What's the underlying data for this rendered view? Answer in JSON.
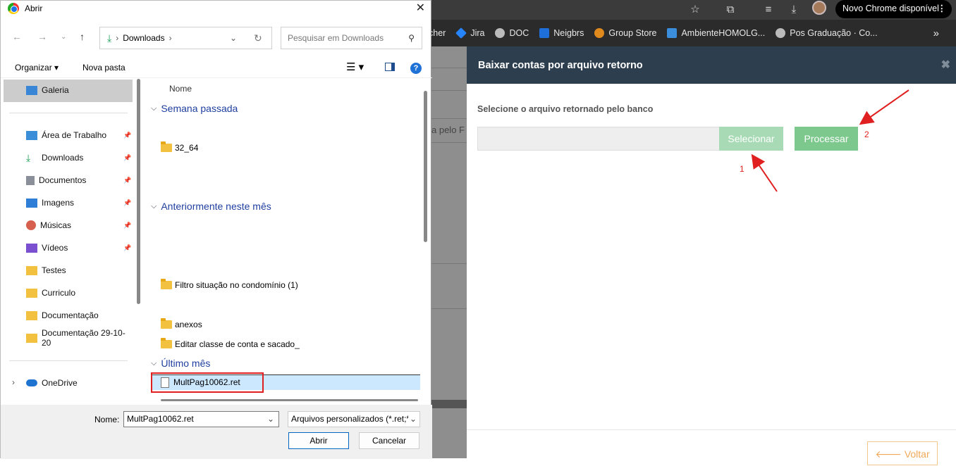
{
  "dialog": {
    "title": "Abrir",
    "address": {
      "crumb": "Downloads"
    },
    "search_placeholder": "Pesquisar em Downloads",
    "organize_label": "Organizar",
    "new_folder_label": "Nova pasta",
    "nav_items": [
      {
        "label": "Galeria",
        "pinned": false
      },
      {
        "label": "Área de Trabalho",
        "pinned": true
      },
      {
        "label": "Downloads",
        "pinned": true
      },
      {
        "label": "Documentos",
        "pinned": true
      },
      {
        "label": "Imagens",
        "pinned": true
      },
      {
        "label": "Músicas",
        "pinned": true
      },
      {
        "label": "Vídeos",
        "pinned": true
      },
      {
        "label": "Testes",
        "pinned": false
      },
      {
        "label": "Curriculo",
        "pinned": false
      },
      {
        "label": "Documentação",
        "pinned": false
      },
      {
        "label": "Documentação 29-10-20",
        "pinned": false
      },
      {
        "label": "OneDrive",
        "pinned": false
      }
    ],
    "column_header": "Nome",
    "groups": [
      {
        "label": "Semana passada"
      },
      {
        "label": "Anteriormente neste mês"
      },
      {
        "label": "Último mês"
      }
    ],
    "files": [
      {
        "name": "32_64"
      },
      {
        "name": "Filtro situação no condomínio (1)"
      },
      {
        "name": "anexos"
      },
      {
        "name": "Editar classe de conta e sacado_"
      },
      {
        "name": "MultPag10062.ret"
      }
    ],
    "name_label": "Nome:",
    "name_value": "MultPag10062.ret",
    "file_type": "Arquivos personalizados (*.ret;*",
    "open_button": "Abrir",
    "cancel_button": "Cancelar"
  },
  "browser": {
    "update_label": "Novo Chrome disponível",
    "bookmarks": [
      {
        "label": "cher",
        "color": "#2b2b2b"
      },
      {
        "label": "Jira",
        "color": "#2684ff"
      },
      {
        "label": "DOC",
        "color": "#bbbbbb"
      },
      {
        "label": "Neigbrs",
        "color": "#1e6fd9"
      },
      {
        "label": "Group Store",
        "color": "#e08a1e"
      },
      {
        "label": "AmbienteHOMOLG...",
        "color": "#3a8edc"
      },
      {
        "label": "Pos Graduação · Co...",
        "color": "#bbbbbb"
      }
    ],
    "page_partial_text": "a pelo F"
  },
  "modal": {
    "title": "Baixar contas por arquivo retorno",
    "label": "Selecione o arquivo retornado pelo banco",
    "select_button": "Selecionar",
    "process_button": "Processar",
    "back_button": "Voltar",
    "annotation_1": "1",
    "annotation_2": "2"
  },
  "colors": {
    "modal_header": "#2d3e4f",
    "select_button": "#a8dbb5",
    "process_button": "#7dc98d",
    "back_border": "#f3c68e",
    "annotation": "#e02020",
    "group_header": "#1f3fa0"
  }
}
